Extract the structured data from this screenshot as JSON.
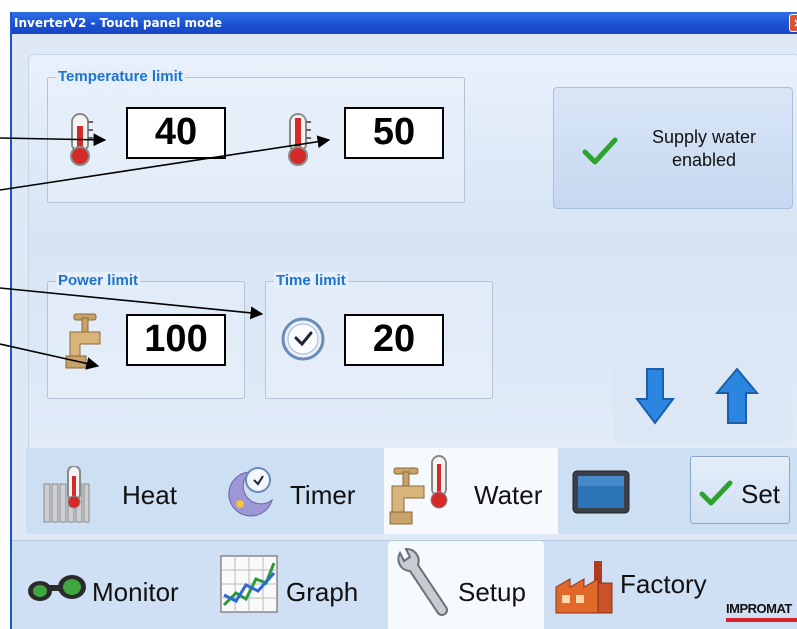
{
  "window": {
    "title": "InverterV2 - Touch panel mode",
    "close_glyph": "×"
  },
  "temperature_group": {
    "legend": "Temperature limit",
    "low_value": "40",
    "high_value": "50"
  },
  "supply_water": {
    "label": "Supply water enabled",
    "icon": "check-icon"
  },
  "power_group": {
    "legend": "Power limit",
    "value": "100"
  },
  "time_group": {
    "legend": "Time limit",
    "value": "20"
  },
  "arrows": {
    "down_icon": "arrow-down-icon",
    "up_icon": "arrow-up-icon"
  },
  "subtabs": {
    "heat": "Heat",
    "timer": "Timer",
    "water": "Water",
    "display_icon": "monitor-screen-icon",
    "set": "Set"
  },
  "maintabs": {
    "monitor": "Monitor",
    "graph": "Graph",
    "setup": "Setup",
    "factory": "Factory"
  },
  "brand": {
    "logo_text": "IMPROMAT",
    "accent_color": "#d6232a"
  },
  "colors": {
    "title_bar": "#1a4fcf",
    "legend_text": "#1d74cf",
    "check_green": "#2fa12f",
    "arrow_blue": "#2a86e0"
  }
}
